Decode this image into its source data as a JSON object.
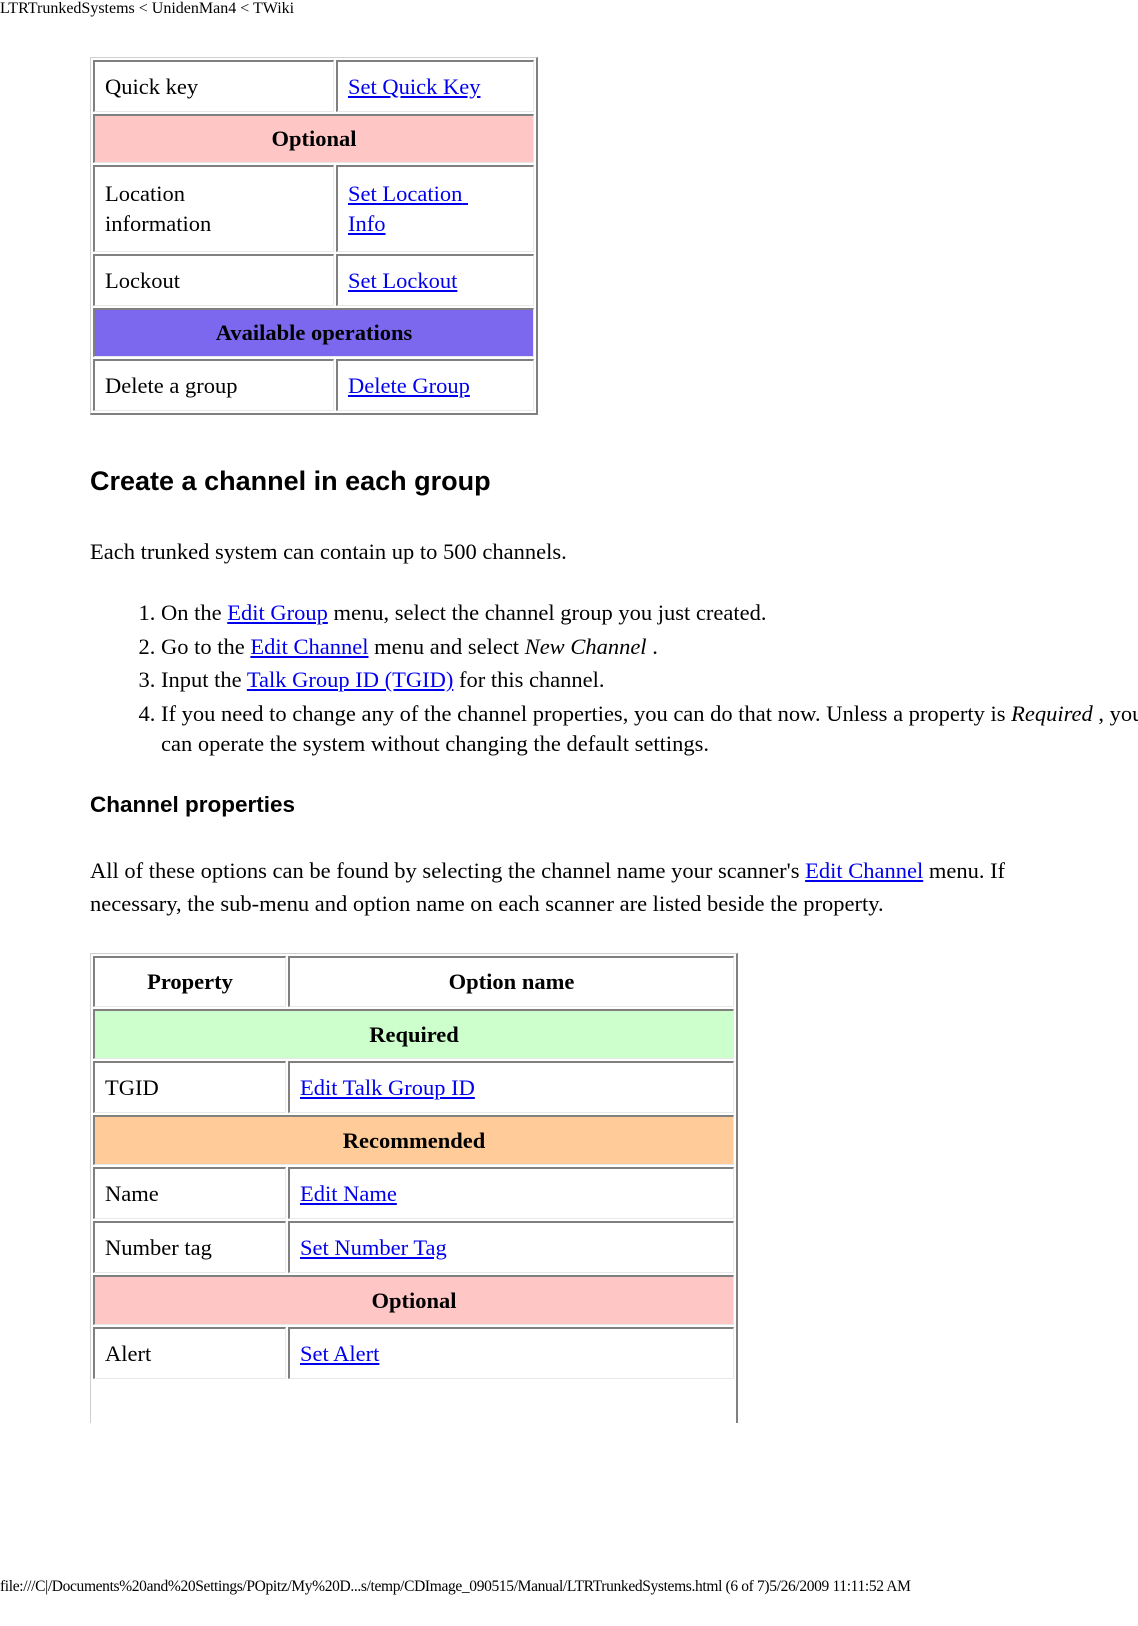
{
  "page": {
    "title": "LTRTrunkedSystems < UnidenMan4 < TWiki",
    "footer": "file:///C|/Documents%20and%20Settings/POpitz/My%20D...s/temp/CDImage_090515/Manual/LTRTrunkedSystems.html (6 of 7)5/26/2009 11:11:52 AM"
  },
  "group_table": {
    "rows": [
      {
        "type": "row",
        "property": "Quick key",
        "option": "Set Quick Key"
      },
      {
        "type": "section",
        "label": "Optional",
        "color": "#ffc6c6"
      },
      {
        "type": "row",
        "property": "Location information",
        "option_line1": "Set Location",
        "option_line2": "Info"
      },
      {
        "type": "row",
        "property": "Lockout",
        "option": "Set Lockout"
      },
      {
        "type": "section",
        "label": "Available operations",
        "color": "#7b68ee"
      },
      {
        "type": "row",
        "property": "Delete a group",
        "option": "Delete Group"
      }
    ]
  },
  "create_channel": {
    "heading": "Create a channel in each group",
    "intro": "Each trunked system can contain up to 500 channels.",
    "steps": [
      {
        "pre": "On the ",
        "link": "Edit Group",
        "post": " menu, select the channel group you just created."
      },
      {
        "pre": "Go to the ",
        "link": "Edit Channel",
        "post": " menu and select ",
        "em": "New Channel",
        "tail": " ."
      },
      {
        "pre": "Input the ",
        "link": "Talk Group ID (TGID)",
        "post": " for this channel."
      },
      {
        "text": "If you need to change any of the channel properties, you can do that now. Unless a property is ",
        "em": "Required",
        "tail": " , you can operate the system without changing the default settings."
      }
    ]
  },
  "channel_properties": {
    "heading": "Channel properties",
    "intro_pre": "All of these options can be found by selecting the channel name your scanner's ",
    "intro_link": "Edit Channel",
    "intro_post": " menu. If necessary, the sub-menu and option name on each scanner are listed beside the property.",
    "table": {
      "headers": [
        "Property",
        "Option name"
      ],
      "rows": [
        {
          "type": "section",
          "label": "Required",
          "color": "#ccffcc"
        },
        {
          "type": "row",
          "property": "TGID",
          "option": "Edit Talk Group ID"
        },
        {
          "type": "section",
          "label": "Recommended",
          "color": "#ffcc99"
        },
        {
          "type": "row",
          "property": "Name",
          "option": "Edit Name"
        },
        {
          "type": "row",
          "property": "Number tag",
          "option": "Set Number Tag"
        },
        {
          "type": "section",
          "label": "Optional",
          "color": "#ffc6c6"
        },
        {
          "type": "row",
          "property": "Alert",
          "option": "Set Alert"
        }
      ]
    }
  }
}
